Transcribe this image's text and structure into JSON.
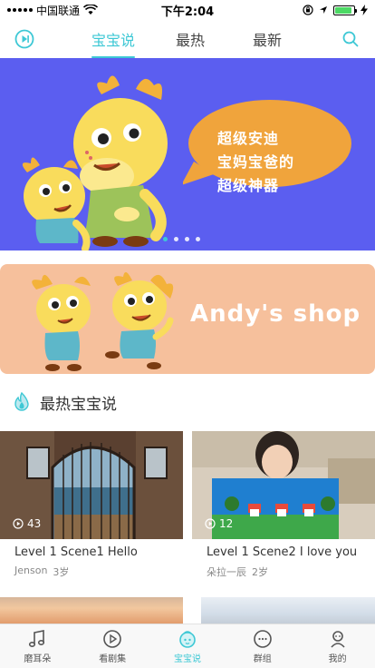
{
  "status_bar": {
    "carrier": "中国联通",
    "time": "下午2:04",
    "battery_percent": 90
  },
  "top_nav": {
    "tabs": [
      {
        "label": "宝宝说",
        "active": true
      },
      {
        "label": "最热",
        "active": false
      },
      {
        "label": "最新",
        "active": false
      }
    ],
    "left_icon": "play-circle-icon",
    "right_icon": "search-icon"
  },
  "banner": {
    "bubble_lines": [
      "超级安迪",
      "宝妈宝爸的",
      "超级神器"
    ],
    "page_count": 4,
    "active_page": 1
  },
  "shop": {
    "title": "Andy's shop"
  },
  "section": {
    "title": "最热宝宝说",
    "icon": "flame-icon"
  },
  "videos": [
    {
      "views": "43",
      "title": "Level 1 Scene1 Hello",
      "author": "Jenson",
      "age": "3岁"
    },
    {
      "views": "12",
      "title": "Level 1 Scene2 I love you",
      "author": "朵拉一辰",
      "age": "2岁"
    }
  ],
  "bottom_tabs": [
    {
      "label": "磨耳朵",
      "icon": "music-note-icon",
      "active": false
    },
    {
      "label": "看剧集",
      "icon": "play-icon",
      "active": false
    },
    {
      "label": "宝宝说",
      "icon": "baby-face-icon",
      "active": true
    },
    {
      "label": "群组",
      "icon": "chat-icon",
      "active": false
    },
    {
      "label": "我的",
      "icon": "profile-icon",
      "active": false
    }
  ],
  "colors": {
    "accent": "#3ec8d5",
    "banner_bg": "#5b5ef0",
    "bubble": "#f0a43c",
    "shop_bg": "#f6c09c"
  }
}
